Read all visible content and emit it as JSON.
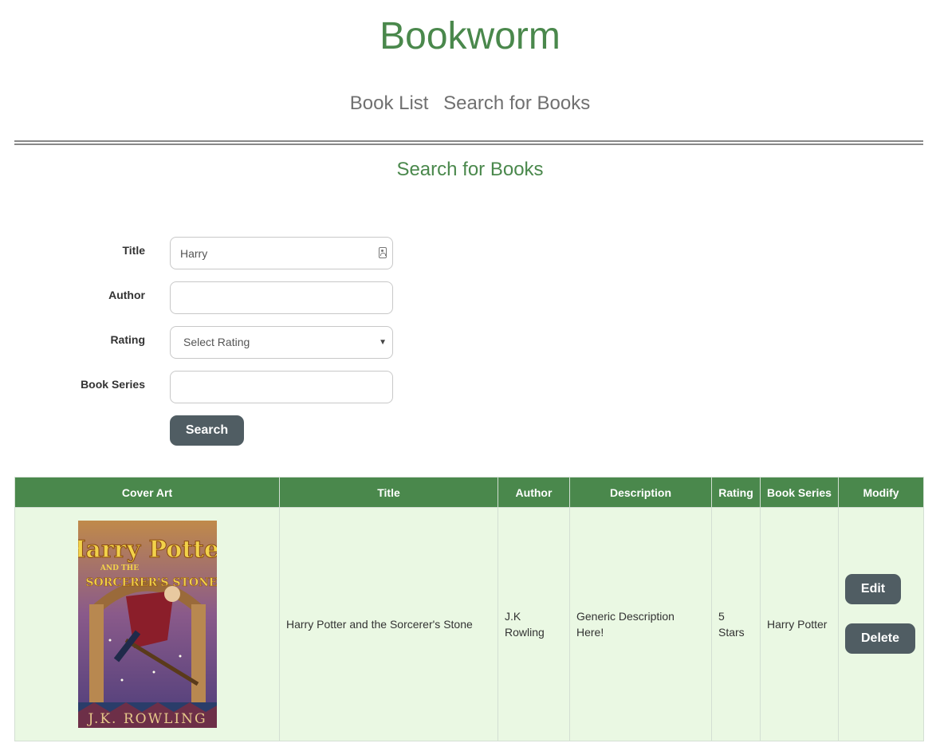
{
  "app": {
    "title": "Bookworm"
  },
  "nav": {
    "items": [
      "Book List",
      "Search for Books"
    ]
  },
  "page": {
    "title": "Search for Books"
  },
  "form": {
    "title_label": "Title",
    "title_value": "Harry",
    "author_label": "Author",
    "author_value": "",
    "rating_label": "Rating",
    "rating_selected": "Select Rating",
    "series_label": "Book Series",
    "series_value": "",
    "search_button": "Search"
  },
  "table": {
    "headers": [
      "Cover Art",
      "Title",
      "Author",
      "Description",
      "Rating",
      "Book Series",
      "Modify"
    ],
    "rows": [
      {
        "cover": {
          "title_line1": "Harry Potter",
          "title_line2": "AND THE",
          "title_line3": "SORCERER'S STONE",
          "author": "J.K. ROWLING"
        },
        "title": "Harry Potter and the Sorcerer's Stone",
        "author": "J.K Rowling",
        "description": "Generic Description Here!",
        "rating": "5 Stars",
        "series": "Harry Potter",
        "edit_label": "Edit",
        "delete_label": "Delete"
      }
    ]
  },
  "colors": {
    "brand_green": "#4a884c",
    "row_bg": "#eaf8e3",
    "button_bg": "#505d63"
  }
}
